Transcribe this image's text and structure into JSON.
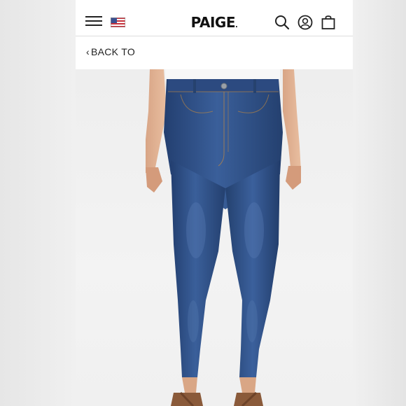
{
  "header": {
    "logo_text": "PAIGE",
    "logo_mark": ".",
    "menu_icon": "hamburger-icon",
    "flag_icon": "us-flag-icon",
    "search_icon": "search-icon",
    "account_icon": "account-icon",
    "bag_icon": "shopping-bag-icon"
  },
  "nav": {
    "back_chevron": "‹",
    "back_label": "BACK TO"
  },
  "product": {
    "image_icon": "jeans-photo"
  },
  "colors": {
    "denim": "#2f4f86",
    "background": "#ffffff",
    "text": "#222222"
  }
}
